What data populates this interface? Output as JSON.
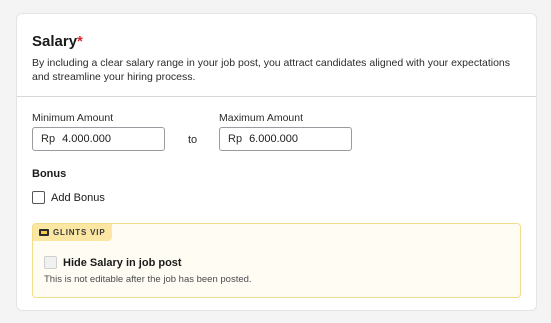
{
  "salary": {
    "title": "Salary",
    "required_mark": "*",
    "description": "By including a clear salary range in your job post, you attract candidates aligned with your expectations and streamline your hiring process.",
    "minimum": {
      "label": "Minimum Amount",
      "prefix": "Rp",
      "value": "4.000.000"
    },
    "separator": "to",
    "maximum": {
      "label": "Maximum Amount",
      "prefix": "Rp",
      "value": "6.000.000"
    }
  },
  "bonus": {
    "label": "Bonus",
    "checkbox_label": "Add Bonus",
    "checked": false
  },
  "vip": {
    "badge_label": "GLINTS VIP",
    "badge_icon": "vip-ticket-icon",
    "hide_salary_label": "Hide Salary in job post",
    "hide_salary_checked": false,
    "note": "This is not editable after the job has been posted."
  },
  "colors": {
    "required": "#e0242c",
    "vip_background": "#fffdf3",
    "vip_border": "#f2dd8a",
    "vip_badge": "#fbe7a3"
  }
}
